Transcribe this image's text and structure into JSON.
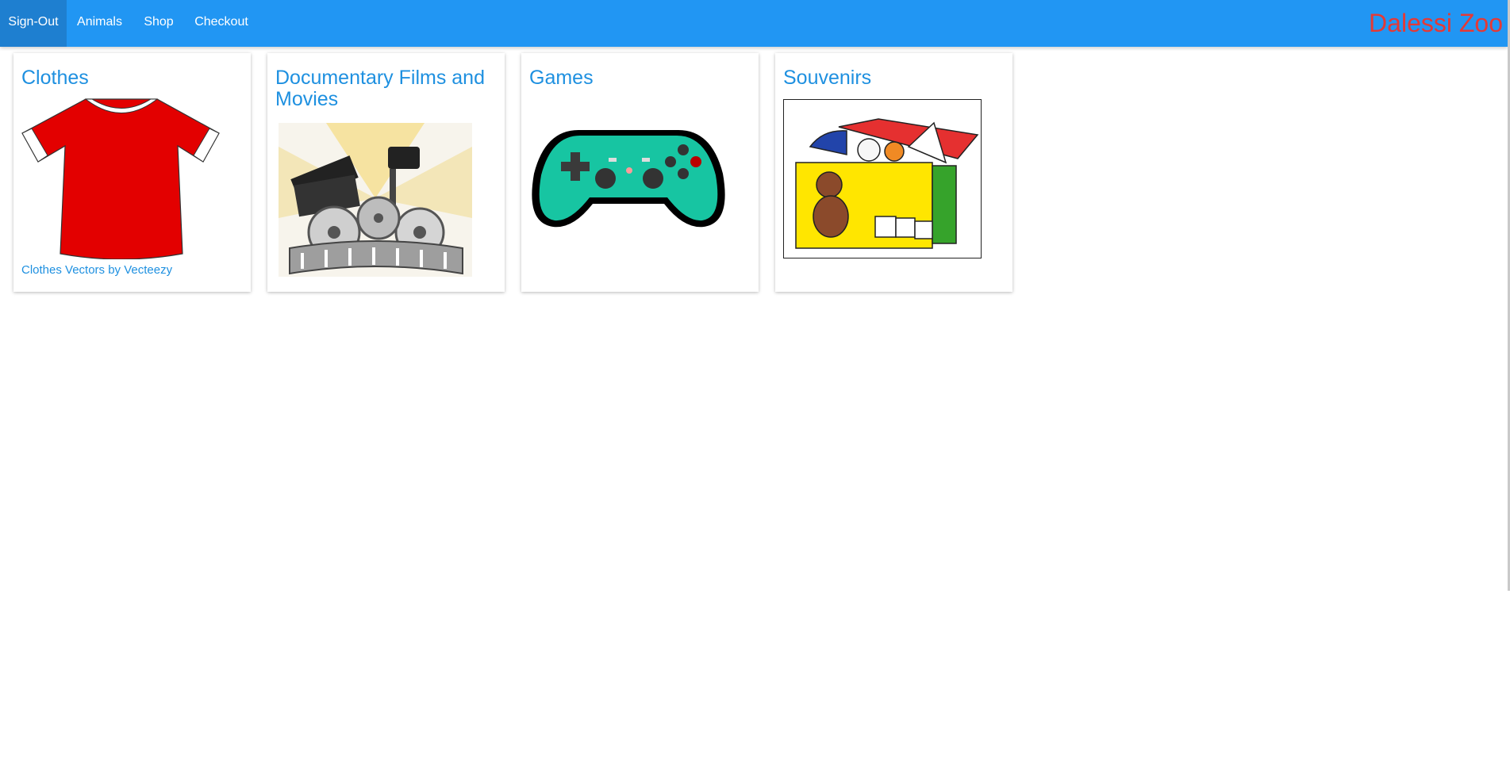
{
  "navbar": {
    "items": [
      {
        "label": "Sign-Out"
      },
      {
        "label": "Animals"
      },
      {
        "label": "Shop"
      },
      {
        "label": "Checkout"
      }
    ],
    "brand": "Dalessi Zoo"
  },
  "categories": [
    {
      "title": "Clothes",
      "icon": "tshirt-icon",
      "credit": "Clothes Vectors by Vecteezy"
    },
    {
      "title": "Documentary Films and Movies",
      "icon": "film-reel-icon"
    },
    {
      "title": "Games",
      "icon": "gamepad-icon"
    },
    {
      "title": "Souvenirs",
      "icon": "toy-box-icon"
    }
  ],
  "colors": {
    "navbar": "#2196f3",
    "navbar_active": "#1e7fd0",
    "brand": "#e53935",
    "link": "#1e90e0"
  }
}
